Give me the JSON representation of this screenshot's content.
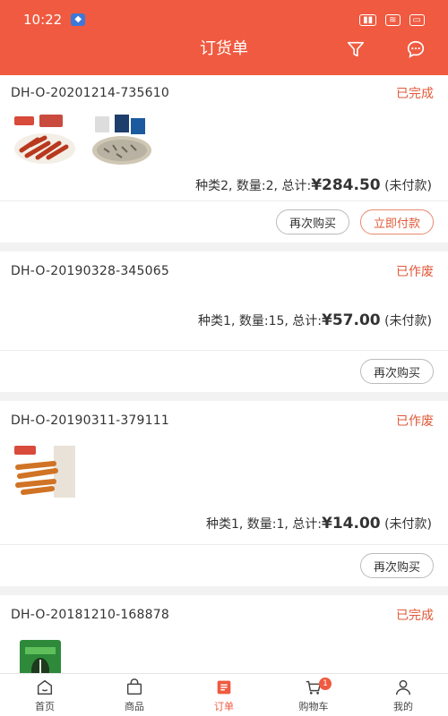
{
  "status_bar": {
    "time": "10:22"
  },
  "header": {
    "title": "订货单"
  },
  "orders": [
    {
      "number": "DH-O-20201214-735610",
      "status": "已完成",
      "summary_prefix": "种类2, 数量:2, 总计:",
      "amount": "¥284.50",
      "payment": " (未付款)",
      "actions": [
        "再次购买",
        "立即付款"
      ]
    },
    {
      "number": "DH-O-20190328-345065",
      "status": "已作废",
      "summary_prefix": "种类1, 数量:15, 总计:",
      "amount": "¥57.00",
      "payment": " (未付款)",
      "actions": [
        "再次购买"
      ]
    },
    {
      "number": "DH-O-20190311-379111",
      "status": "已作废",
      "summary_prefix": "种类1, 数量:1, 总计:",
      "amount": "¥14.00",
      "payment": " (未付款)",
      "actions": [
        "再次购买"
      ]
    },
    {
      "number": "DH-O-20181210-168878",
      "status": "已完成"
    }
  ],
  "tabbar": {
    "items": [
      {
        "label": "首页",
        "icon": "home-icon"
      },
      {
        "label": "商品",
        "icon": "bag-icon"
      },
      {
        "label": "订单",
        "icon": "order-icon"
      },
      {
        "label": "购物车",
        "icon": "cart-icon",
        "badge": "1"
      },
      {
        "label": "我的",
        "icon": "user-icon"
      }
    ],
    "active_index": 2
  },
  "colors": {
    "brand": "#f05a40",
    "status": "#e15a3a"
  }
}
